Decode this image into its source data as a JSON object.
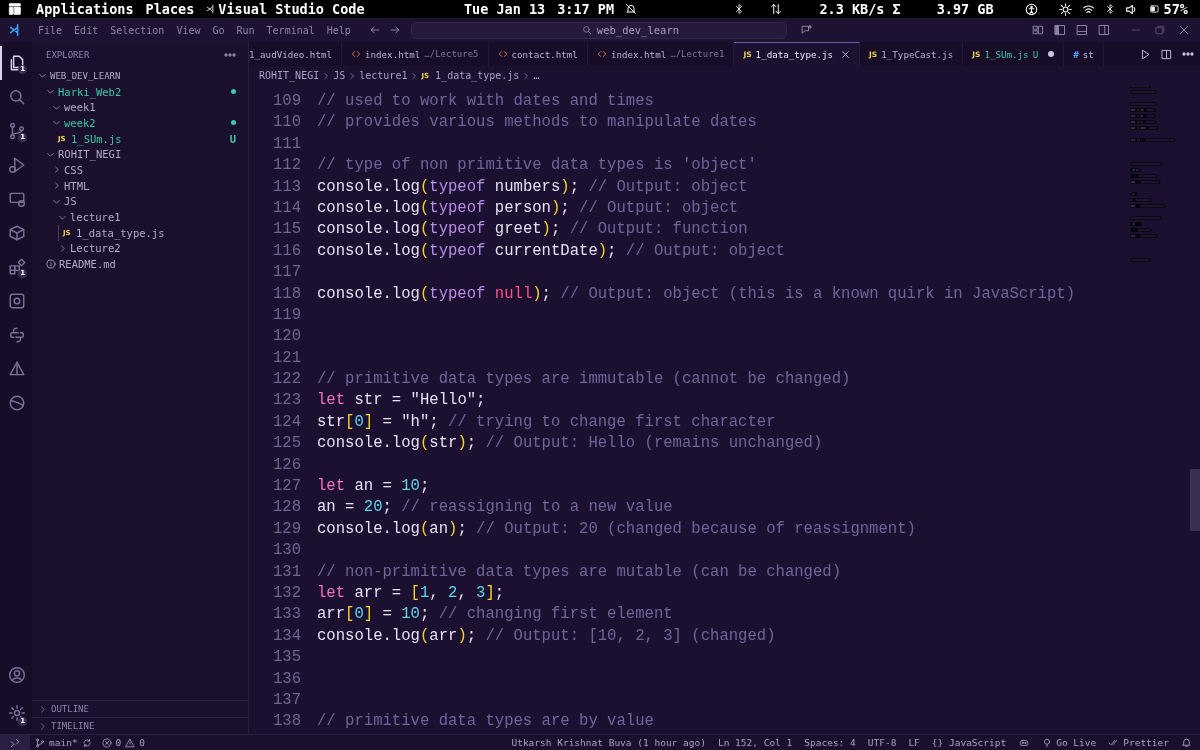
{
  "system_bar": {
    "applications": "Applications",
    "places": "Places",
    "app": "Visual Studio Code",
    "date": "Tue Jan 13",
    "time": "3:17 PM",
    "network": "2.3 KB/s Σ",
    "memory": "3.97 GB",
    "battery": "57%"
  },
  "menu": [
    "File",
    "Edit",
    "Selection",
    "View",
    "Go",
    "Run",
    "Terminal",
    "Help"
  ],
  "command_center": {
    "value": "web_dev_learn"
  },
  "activity_bar": [
    {
      "kind": "files",
      "selected": true,
      "badge": "1"
    },
    {
      "kind": "search",
      "selected": false
    },
    {
      "kind": "source-control",
      "selected": false,
      "badge": "1"
    },
    {
      "kind": "run",
      "selected": false
    },
    {
      "kind": "remote",
      "selected": false
    },
    {
      "kind": "box",
      "selected": false
    },
    {
      "kind": "extensions",
      "selected": false,
      "badge": "1"
    },
    {
      "kind": "docker",
      "selected": false
    },
    {
      "kind": "python",
      "selected": false
    },
    {
      "kind": "triangle",
      "selected": false
    },
    {
      "kind": "ball",
      "selected": false
    }
  ],
  "activity_bottom": [
    {
      "kind": "account"
    },
    {
      "kind": "settings",
      "badge": "1"
    }
  ],
  "explorer": {
    "title": "EXPLORER",
    "tree": [
      {
        "label": "WEB_DEV_LEARN",
        "kind": "root",
        "expanded": true,
        "children": [
          {
            "label": "Harki_Web2",
            "kind": "folder",
            "expanded": true,
            "color": "#39c9a6",
            "dot": true,
            "children": [
              {
                "label": "week1",
                "kind": "folder",
                "expanded": true
              },
              {
                "label": "week2",
                "kind": "folder",
                "expanded": true,
                "color": "#39c9a6",
                "dot": true,
                "children": [
                  {
                    "label": "1_SUm.js",
                    "kind": "file",
                    "icon": "JS",
                    "color": "#39c9a6",
                    "badge": "U"
                  }
                ]
              }
            ]
          },
          {
            "label": "ROHIT_NEGI",
            "kind": "folder",
            "expanded": true,
            "children": [
              {
                "label": "CSS",
                "kind": "folder",
                "expanded": false
              },
              {
                "label": "HTML",
                "kind": "folder",
                "expanded": false
              },
              {
                "label": "JS",
                "kind": "folder",
                "expanded": true,
                "children": [
                  {
                    "label": "lecture1",
                    "kind": "folder",
                    "expanded": true,
                    "children": [
                      {
                        "label": "1_data_type.js",
                        "kind": "file",
                        "icon": "JS"
                      }
                    ]
                  },
                  {
                    "label": "Lecture2",
                    "kind": "folder",
                    "expanded": false
                  }
                ]
              }
            ]
          },
          {
            "label": "README.md",
            "kind": "info"
          }
        ]
      }
    ],
    "sections": [
      {
        "label": "OUTLINE",
        "expanded": false
      },
      {
        "label": "TIMELINE",
        "expanded": false
      }
    ]
  },
  "tabs": [
    {
      "label": "1_audVideo.html",
      "kind": "plain",
      "selected": false
    },
    {
      "label": "index.html",
      "hint": "…/Lecture5",
      "kind": "html",
      "selected": false
    },
    {
      "label": "contact.html",
      "kind": "html",
      "selected": false
    },
    {
      "label": "index.html",
      "hint": "…/Lecture1",
      "kind": "html",
      "selected": false
    },
    {
      "label": "1_data_type.js",
      "kind": "js",
      "icon": "JS",
      "selected": true
    },
    {
      "label": "1_TypeCast.js",
      "kind": "js",
      "icon": "JS",
      "selected": false
    },
    {
      "label": "1_SUm.js",
      "kind": "js",
      "icon": "JS",
      "selected": false,
      "color": "#39c9a6",
      "badge": "U",
      "modified": true
    },
    {
      "label": "st",
      "kind": "css",
      "icon": "#",
      "selected": false
    }
  ],
  "breadcrumb": [
    {
      "label": "ROHIT_NEGI"
    },
    {
      "label": "JS"
    },
    {
      "label": "lecture1"
    },
    {
      "label": "1_data_type.js",
      "icon": "JS"
    },
    {
      "label": "…"
    }
  ],
  "code": [
    {
      "n": "109",
      "tokens": [
        {
          "kind": "comment",
          "text": "// used to work with dates and times"
        }
      ]
    },
    {
      "n": "110",
      "tokens": [
        {
          "kind": "comment",
          "text": "// provides various methods to manipulate dates"
        }
      ]
    },
    {
      "n": "111"
    },
    {
      "n": "112",
      "tokens": [
        {
          "kind": "comment",
          "text": "// type of non primitive data types is 'object'"
        }
      ]
    },
    {
      "n": "113",
      "tokens": [
        {
          "kind": "ident",
          "text": "console.log"
        },
        {
          "kind": "bracket",
          "text": "("
        },
        {
          "kind": "operator",
          "text": "typeof"
        },
        {
          "kind": "ident",
          "text": " numbers"
        },
        {
          "kind": "bracket",
          "text": ")"
        },
        {
          "kind": "ident",
          "text": "; "
        },
        {
          "kind": "comment",
          "text": "// Output: object"
        }
      ]
    },
    {
      "n": "114",
      "tokens": [
        {
          "kind": "ident",
          "text": "console.log"
        },
        {
          "kind": "bracket",
          "text": "("
        },
        {
          "kind": "operator",
          "text": "typeof"
        },
        {
          "kind": "ident",
          "text": " person"
        },
        {
          "kind": "bracket",
          "text": ")"
        },
        {
          "kind": "ident",
          "text": "; "
        },
        {
          "kind": "comment",
          "text": "// Output: object"
        }
      ]
    },
    {
      "n": "115",
      "tokens": [
        {
          "kind": "ident",
          "text": "console.log"
        },
        {
          "kind": "bracket",
          "text": "("
        },
        {
          "kind": "operator",
          "text": "typeof"
        },
        {
          "kind": "ident",
          "text": " greet"
        },
        {
          "kind": "bracket",
          "text": ")"
        },
        {
          "kind": "ident",
          "text": "; "
        },
        {
          "kind": "comment",
          "text": "// Output: function"
        }
      ]
    },
    {
      "n": "116",
      "tokens": [
        {
          "kind": "ident",
          "text": "console.log"
        },
        {
          "kind": "bracket",
          "text": "("
        },
        {
          "kind": "operator",
          "text": "typeof"
        },
        {
          "kind": "ident",
          "text": " currentDate"
        },
        {
          "kind": "bracket",
          "text": ")"
        },
        {
          "kind": "ident",
          "text": "; "
        },
        {
          "kind": "comment",
          "text": "// Output: object"
        }
      ]
    },
    {
      "n": "117"
    },
    {
      "n": "118",
      "tokens": [
        {
          "kind": "ident",
          "text": "console.log"
        },
        {
          "kind": "bracket",
          "text": "("
        },
        {
          "kind": "operator",
          "text": "typeof "
        },
        {
          "kind": "null",
          "text": "null"
        },
        {
          "kind": "bracket",
          "text": ")"
        },
        {
          "kind": "ident",
          "text": "; "
        },
        {
          "kind": "comment",
          "text": "// Output: object (this is a known quirk in JavaScript)"
        }
      ]
    },
    {
      "n": "119"
    },
    {
      "n": "120"
    },
    {
      "n": "121"
    },
    {
      "n": "122",
      "tokens": [
        {
          "kind": "comment",
          "text": "// primitive data types are immutable (cannot be changed)"
        }
      ]
    },
    {
      "n": "123",
      "tokens": [
        {
          "kind": "keyword",
          "text": "let"
        },
        {
          "kind": "ident",
          "text": " str = "
        },
        {
          "kind": "string",
          "text": "\"Hello\""
        },
        {
          "kind": "ident",
          "text": ";"
        }
      ]
    },
    {
      "n": "124",
      "tokens": [
        {
          "kind": "ident",
          "text": "str"
        },
        {
          "kind": "bracket",
          "text": "["
        },
        {
          "kind": "number",
          "text": "0"
        },
        {
          "kind": "bracket",
          "text": "]"
        },
        {
          "kind": "ident",
          "text": " = "
        },
        {
          "kind": "string",
          "text": "\"h\""
        },
        {
          "kind": "ident",
          "text": "; "
        },
        {
          "kind": "comment",
          "text": "// trying to change first character"
        }
      ]
    },
    {
      "n": "125",
      "tokens": [
        {
          "kind": "ident",
          "text": "console.log"
        },
        {
          "kind": "bracket",
          "text": "("
        },
        {
          "kind": "ident",
          "text": "str"
        },
        {
          "kind": "bracket",
          "text": ")"
        },
        {
          "kind": "ident",
          "text": "; "
        },
        {
          "kind": "comment",
          "text": "// Output: Hello (remains unchanged)"
        }
      ]
    },
    {
      "n": "126"
    },
    {
      "n": "127",
      "tokens": [
        {
          "kind": "keyword",
          "text": "let"
        },
        {
          "kind": "ident",
          "text": " an = "
        },
        {
          "kind": "number",
          "text": "10"
        },
        {
          "kind": "ident",
          "text": ";"
        }
      ]
    },
    {
      "n": "128",
      "tokens": [
        {
          "kind": "ident",
          "text": "an = "
        },
        {
          "kind": "number",
          "text": "20"
        },
        {
          "kind": "ident",
          "text": "; "
        },
        {
          "kind": "comment",
          "text": "// reassigning to a new value"
        }
      ]
    },
    {
      "n": "129",
      "tokens": [
        {
          "kind": "ident",
          "text": "console.log"
        },
        {
          "kind": "bracket",
          "text": "("
        },
        {
          "kind": "ident",
          "text": "an"
        },
        {
          "kind": "bracket",
          "text": ")"
        },
        {
          "kind": "ident",
          "text": "; "
        },
        {
          "kind": "comment",
          "text": "// Output: 20 (changed because of reassignment)"
        }
      ]
    },
    {
      "n": "130"
    },
    {
      "n": "131",
      "tokens": [
        {
          "kind": "comment",
          "text": "// non-primitive data types are mutable (can be changed)"
        }
      ]
    },
    {
      "n": "132",
      "tokens": [
        {
          "kind": "keyword",
          "text": "let"
        },
        {
          "kind": "ident",
          "text": " arr = "
        },
        {
          "kind": "bracket",
          "text": "["
        },
        {
          "kind": "number",
          "text": "1"
        },
        {
          "kind": "ident",
          "text": ", "
        },
        {
          "kind": "number",
          "text": "2"
        },
        {
          "kind": "ident",
          "text": ", "
        },
        {
          "kind": "number",
          "text": "3"
        },
        {
          "kind": "bracket",
          "text": "]"
        },
        {
          "kind": "ident",
          "text": ";"
        }
      ]
    },
    {
      "n": "133",
      "tokens": [
        {
          "kind": "ident",
          "text": "arr"
        },
        {
          "kind": "bracket",
          "text": "["
        },
        {
          "kind": "number",
          "text": "0"
        },
        {
          "kind": "bracket",
          "text": "]"
        },
        {
          "kind": "ident",
          "text": " = "
        },
        {
          "kind": "number",
          "text": "10"
        },
        {
          "kind": "ident",
          "text": "; "
        },
        {
          "kind": "comment",
          "text": "// changing first element"
        }
      ]
    },
    {
      "n": "134",
      "tokens": [
        {
          "kind": "ident",
          "text": "console.log"
        },
        {
          "kind": "bracket",
          "text": "("
        },
        {
          "kind": "ident",
          "text": "arr"
        },
        {
          "kind": "bracket",
          "text": ")"
        },
        {
          "kind": "ident",
          "text": "; "
        },
        {
          "kind": "comment",
          "text": "// Output: [10, 2, 3] (changed)"
        }
      ]
    },
    {
      "n": "135"
    },
    {
      "n": "136"
    },
    {
      "n": "137"
    },
    {
      "n": "138",
      "tokens": [
        {
          "kind": "comment",
          "text": "// primitive data types are by value"
        }
      ]
    }
  ],
  "status_bar": {
    "branch": "main*",
    "errors": "0",
    "warnings": "0",
    "right": [
      {
        "kind": "text",
        "label": "Utkarsh Krishnat Buva (1 hour ago)"
      },
      {
        "kind": "text",
        "label": "Ln 152, Col 1"
      },
      {
        "kind": "text",
        "label": "Spaces: 4"
      },
      {
        "kind": "text",
        "label": "UTF-8"
      },
      {
        "kind": "text",
        "label": "LF"
      },
      {
        "kind": "text",
        "label": "{} JavaScript"
      },
      {
        "kind": "copilot"
      },
      {
        "kind": "live",
        "label": "Go Live"
      },
      {
        "kind": "prettier",
        "label": "Prettier"
      },
      {
        "kind": "bell"
      }
    ]
  }
}
